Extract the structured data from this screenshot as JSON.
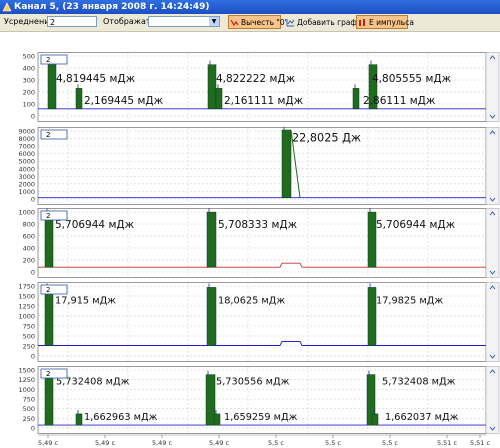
{
  "window": {
    "title": "Канал 5, (23 января 2008 г. 14:24:49)"
  },
  "toolbar": {
    "smoothing_label": "Усреднение:",
    "smoothing_value": "2",
    "display_label": "Отображать:",
    "display_value": "",
    "subtract_zero_label": "Вычесть \"0\"",
    "add_chart_label": "Добавить график",
    "pulse_energy_label": "Е импульса"
  },
  "colors": {
    "pulse": "#1f6b1f",
    "trace": "#2020d0",
    "accent": "#c03030",
    "grid": "#c8c8c8"
  },
  "x_axis": {
    "ticks": [
      "5,49 с",
      "5,49 с",
      "5,49 с",
      "5,49 с",
      "5,5 с",
      "5,5 с",
      "5,5 с",
      "5,51 с",
      "5,51 с"
    ]
  },
  "panels": [
    {
      "label": "2",
      "yticks": [
        "500",
        "400",
        "300",
        "200",
        "100",
        "0"
      ],
      "annotations": [
        "4,819445 мДж",
        "2,169445 мДж",
        "4,822222 мДж",
        "2,161111 мДж",
        "4,805555 мДж",
        "2,86111 мДж"
      ]
    },
    {
      "label": "2",
      "yticks": [
        "9000",
        "8000",
        "7000",
        "6000",
        "5000",
        "4000",
        "3000",
        "2000",
        "1000",
        "0"
      ],
      "annotations": [
        "22,8025 Дж"
      ]
    },
    {
      "label": "2",
      "yticks": [
        "1000",
        "800",
        "600",
        "400",
        "200",
        "0"
      ],
      "annotations": [
        "5,706944 мДж",
        "5,708333 мДж",
        "5,706944 мДж"
      ]
    },
    {
      "label": "2",
      "yticks": [
        "1750",
        "1500",
        "1250",
        "1000",
        "750",
        "500",
        "250",
        "0"
      ],
      "annotations": [
        "17,915 мДж",
        "18,0625 мДж",
        "17,9825 мДж"
      ]
    },
    {
      "label": "2",
      "yticks": [
        "1500",
        "1250",
        "1000",
        "750",
        "500",
        "250",
        "0"
      ],
      "annotations": [
        "5,732408 мДж",
        "1,662963 мДж",
        "5,730556 мДж",
        "1,659259 мДж",
        "5,732408 мДж",
        "1,662037 мДж"
      ]
    }
  ]
}
